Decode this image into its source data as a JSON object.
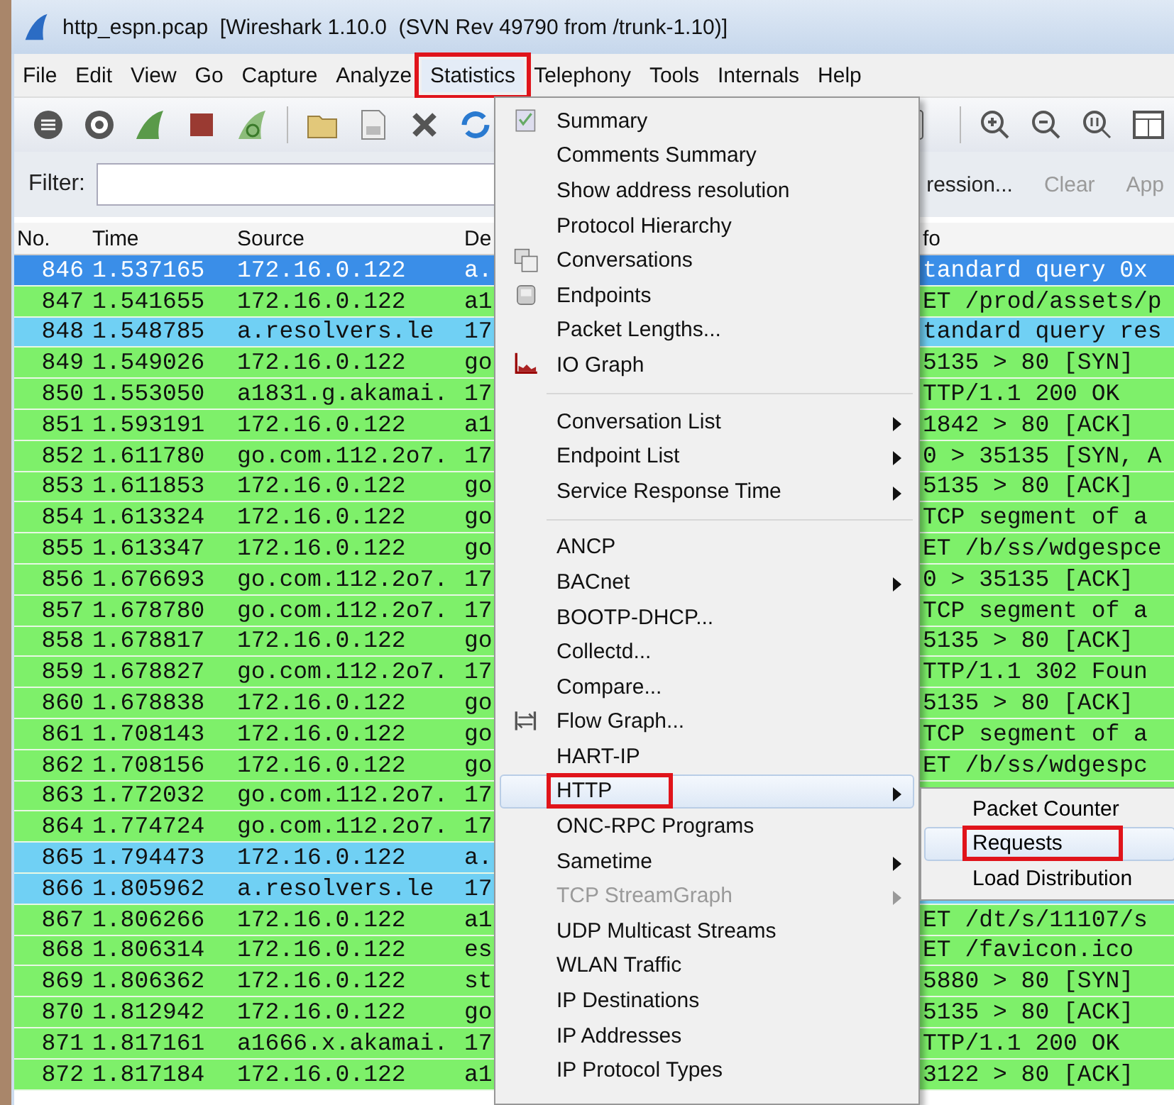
{
  "window": {
    "title": "http_espn.pcap  [Wireshark 1.10.0  (SVN Rev 49790 from /trunk-1.10)]"
  },
  "menu_bar": [
    {
      "label": "File",
      "selected": false,
      "highlighted": false
    },
    {
      "label": "Edit",
      "selected": false,
      "highlighted": false
    },
    {
      "label": "View",
      "selected": false,
      "highlighted": false
    },
    {
      "label": "Go",
      "selected": false,
      "highlighted": false
    },
    {
      "label": "Capture",
      "selected": false,
      "highlighted": false
    },
    {
      "label": "Analyze",
      "selected": false,
      "highlighted": false
    },
    {
      "label": "Statistics",
      "selected": true,
      "highlighted": true
    },
    {
      "label": "Telephony",
      "selected": false,
      "highlighted": false
    },
    {
      "label": "Tools",
      "selected": false,
      "highlighted": false
    },
    {
      "label": "Internals",
      "selected": false,
      "highlighted": false
    },
    {
      "label": "Help",
      "selected": false,
      "highlighted": false
    }
  ],
  "filter_bar": {
    "label": "Filter:",
    "buttons": [
      "ression...",
      "Clear",
      "App"
    ]
  },
  "packet_list": {
    "columns": [
      "No.",
      "Time",
      "Source",
      "De",
      "fo"
    ],
    "rows": [
      {
        "no": "846",
        "time": "1.537165",
        "source": "172.16.0.122",
        "destination": "a.",
        "info": "tandard query 0x",
        "color": "#3a8ee8",
        "selected": true
      },
      {
        "no": "847",
        "time": "1.541655",
        "source": "172.16.0.122",
        "destination": "a1",
        "info": "ET /prod/assets/p",
        "color": "#7ef06a",
        "selected": false
      },
      {
        "no": "848",
        "time": "1.548785",
        "source": "a.resolvers.le",
        "destination": "17",
        "info": "tandard query res",
        "color": "#70d0f4",
        "selected": false
      },
      {
        "no": "849",
        "time": "1.549026",
        "source": "172.16.0.122",
        "destination": "go",
        "info": "5135 > 80 [SYN]",
        "color": "#7ef06a",
        "selected": false
      },
      {
        "no": "850",
        "time": "1.553050",
        "source": "a1831.g.akamai.",
        "destination": "17",
        "info": "TTP/1.1 200 OK",
        "color": "#7ef06a",
        "selected": false
      },
      {
        "no": "851",
        "time": "1.593191",
        "source": "172.16.0.122",
        "destination": "a1",
        "info": "1842 > 80 [ACK]",
        "color": "#7ef06a",
        "selected": false
      },
      {
        "no": "852",
        "time": "1.611780",
        "source": "go.com.112.2o7.",
        "destination": "17",
        "info": "0 > 35135 [SYN, A",
        "color": "#7ef06a",
        "selected": false
      },
      {
        "no": "853",
        "time": "1.611853",
        "source": "172.16.0.122",
        "destination": "go",
        "info": "5135 > 80 [ACK]",
        "color": "#7ef06a",
        "selected": false
      },
      {
        "no": "854",
        "time": "1.613324",
        "source": "172.16.0.122",
        "destination": "go",
        "info": "TCP segment of a",
        "color": "#7ef06a",
        "selected": false
      },
      {
        "no": "855",
        "time": "1.613347",
        "source": "172.16.0.122",
        "destination": "go",
        "info": "ET /b/ss/wdgespce",
        "color": "#7ef06a",
        "selected": false
      },
      {
        "no": "856",
        "time": "1.676693",
        "source": "go.com.112.2o7.",
        "destination": "17",
        "info": "0 > 35135 [ACK]",
        "color": "#7ef06a",
        "selected": false
      },
      {
        "no": "857",
        "time": "1.678780",
        "source": "go.com.112.2o7.",
        "destination": "17",
        "info": "TCP segment of a",
        "color": "#7ef06a",
        "selected": false
      },
      {
        "no": "858",
        "time": "1.678817",
        "source": "172.16.0.122",
        "destination": "go",
        "info": "5135 > 80 [ACK]",
        "color": "#7ef06a",
        "selected": false
      },
      {
        "no": "859",
        "time": "1.678827",
        "source": "go.com.112.2o7.",
        "destination": "17",
        "info": "TTP/1.1 302 Foun",
        "color": "#7ef06a",
        "selected": false
      },
      {
        "no": "860",
        "time": "1.678838",
        "source": "172.16.0.122",
        "destination": "go",
        "info": "5135 > 80 [ACK]",
        "color": "#7ef06a",
        "selected": false
      },
      {
        "no": "861",
        "time": "1.708143",
        "source": "172.16.0.122",
        "destination": "go",
        "info": "TCP segment of a",
        "color": "#7ef06a",
        "selected": false
      },
      {
        "no": "862",
        "time": "1.708156",
        "source": "172.16.0.122",
        "destination": "go",
        "info": "ET /b/ss/wdgespc",
        "color": "#7ef06a",
        "selected": false
      },
      {
        "no": "863",
        "time": "1.772032",
        "source": "go.com.112.2o7.",
        "destination": "17",
        "color": "#7ef06a",
        "selected": false
      },
      {
        "no": "864",
        "time": "1.774724",
        "source": "go.com.112.2o7.",
        "destination": "17",
        "color": "#7ef06a",
        "selected": false
      },
      {
        "no": "865",
        "time": "1.794473",
        "source": "172.16.0.122",
        "destination": "a.",
        "color": "#70d0f4",
        "selected": false
      },
      {
        "no": "866",
        "time": "1.805962",
        "source": "a.resolvers.le",
        "destination": "17",
        "color": "#70d0f4",
        "selected": false
      },
      {
        "no": "867",
        "time": "1.806266",
        "source": "172.16.0.122",
        "destination": "a1",
        "info": "ET /dt/s/11107/s",
        "color": "#7ef06a",
        "selected": false
      },
      {
        "no": "868",
        "time": "1.806314",
        "source": "172.16.0.122",
        "destination": "es",
        "info": "ET /favicon.ico",
        "color": "#7ef06a",
        "selected": false
      },
      {
        "no": "869",
        "time": "1.806362",
        "source": "172.16.0.122",
        "destination": "st",
        "info": "5880 > 80 [SYN]",
        "color": "#7ef06a",
        "selected": false
      },
      {
        "no": "870",
        "time": "1.812942",
        "source": "172.16.0.122",
        "destination": "go",
        "info": "5135 > 80 [ACK]",
        "color": "#7ef06a",
        "selected": false
      },
      {
        "no": "871",
        "time": "1.817161",
        "source": "a1666.x.akamai.",
        "destination": "17",
        "info": "TTP/1.1 200 OK",
        "color": "#7ef06a",
        "selected": false
      },
      {
        "no": "872",
        "time": "1.817184",
        "source": "172.16.0.122",
        "destination": "a1",
        "info": "3122 > 80 [ACK]",
        "color": "#7ef06a",
        "selected": false
      }
    ]
  },
  "statistics_menu": [
    {
      "kind": "item",
      "label": "Summary",
      "submenu": false,
      "disabled": false,
      "selected": false,
      "highlighted": false
    },
    {
      "kind": "item",
      "label": "Comments Summary",
      "submenu": false,
      "disabled": false,
      "selected": false,
      "highlighted": false
    },
    {
      "kind": "item",
      "label": "Show address resolution",
      "submenu": false,
      "disabled": false,
      "selected": false,
      "highlighted": false
    },
    {
      "kind": "item",
      "label": "Protocol Hierarchy",
      "submenu": false,
      "disabled": false,
      "selected": false,
      "highlighted": false
    },
    {
      "kind": "item",
      "label": "Conversations",
      "submenu": false,
      "disabled": false,
      "selected": false,
      "highlighted": false
    },
    {
      "kind": "item",
      "label": "Endpoints",
      "submenu": false,
      "disabled": false,
      "selected": false,
      "highlighted": false
    },
    {
      "kind": "item",
      "label": "Packet Lengths...",
      "submenu": false,
      "disabled": false,
      "selected": false,
      "highlighted": false
    },
    {
      "kind": "item",
      "label": "IO Graph",
      "submenu": false,
      "disabled": false,
      "selected": false,
      "highlighted": false
    },
    {
      "kind": "separator"
    },
    {
      "kind": "item",
      "label": "Conversation List",
      "submenu": true,
      "disabled": false,
      "selected": false,
      "highlighted": false
    },
    {
      "kind": "item",
      "label": "Endpoint List",
      "submenu": true,
      "disabled": false,
      "selected": false,
      "highlighted": false
    },
    {
      "kind": "item",
      "label": "Service Response Time",
      "submenu": true,
      "disabled": false,
      "selected": false,
      "highlighted": false
    },
    {
      "kind": "separator"
    },
    {
      "kind": "item",
      "label": "ANCP",
      "submenu": false,
      "disabled": false,
      "selected": false,
      "highlighted": false
    },
    {
      "kind": "item",
      "label": "BACnet",
      "submenu": true,
      "disabled": false,
      "selected": false,
      "highlighted": false
    },
    {
      "kind": "item",
      "label": "BOOTP-DHCP...",
      "submenu": false,
      "disabled": false,
      "selected": false,
      "highlighted": false
    },
    {
      "kind": "item",
      "label": "Collectd...",
      "submenu": false,
      "disabled": false,
      "selected": false,
      "highlighted": false
    },
    {
      "kind": "item",
      "label": "Compare...",
      "submenu": false,
      "disabled": false,
      "selected": false,
      "highlighted": false
    },
    {
      "kind": "item",
      "label": "Flow Graph...",
      "submenu": false,
      "disabled": false,
      "selected": false,
      "highlighted": false
    },
    {
      "kind": "item",
      "label": "HART-IP",
      "submenu": false,
      "disabled": false,
      "selected": false,
      "highlighted": false
    },
    {
      "kind": "item",
      "label": "HTTP",
      "submenu": true,
      "disabled": false,
      "selected": true,
      "highlighted": true
    },
    {
      "kind": "item",
      "label": "ONC-RPC Programs",
      "submenu": false,
      "disabled": false,
      "selected": false,
      "highlighted": false
    },
    {
      "kind": "item",
      "label": "Sametime",
      "submenu": true,
      "disabled": false,
      "selected": false,
      "highlighted": false
    },
    {
      "kind": "item",
      "label": "TCP StreamGraph",
      "submenu": true,
      "disabled": true,
      "selected": false,
      "highlighted": false
    },
    {
      "kind": "item",
      "label": "UDP Multicast Streams",
      "submenu": false,
      "disabled": false,
      "selected": false,
      "highlighted": false
    },
    {
      "kind": "item",
      "label": "WLAN Traffic",
      "submenu": false,
      "disabled": false,
      "selected": false,
      "highlighted": false
    },
    {
      "kind": "item",
      "label": "IP Destinations",
      "submenu": false,
      "disabled": false,
      "selected": false,
      "highlighted": false
    },
    {
      "kind": "item",
      "label": "IP Addresses",
      "submenu": false,
      "disabled": false,
      "selected": false,
      "highlighted": false
    },
    {
      "kind": "item",
      "label": "IP Protocol Types",
      "submenu": false,
      "disabled": false,
      "selected": false,
      "highlighted": false
    }
  ],
  "http_submenu": [
    {
      "label": "Packet Counter",
      "selected": false,
      "highlighted": false
    },
    {
      "label": "Requests",
      "selected": true,
      "highlighted": true
    },
    {
      "label": "Load Distribution",
      "selected": false,
      "highlighted": false
    }
  ]
}
